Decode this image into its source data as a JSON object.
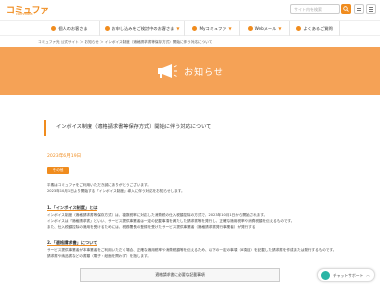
{
  "header": {
    "logo_text": "コミュファ",
    "logo_sub": "commufa",
    "search_placeholder": "サイト内を検索"
  },
  "nav": {
    "items": [
      {
        "label": "個人のお客さま"
      },
      {
        "label": "お申し込みをご検討中のお客さま"
      },
      {
        "label": "Myコミュファ"
      },
      {
        "label": "Webメール"
      },
      {
        "label": "よくあるご質問"
      }
    ]
  },
  "breadcrumb": "コミュファ光 公式サイト ＞ お知らせ ＞ インボイス制度（適格請求書等保存方式）開始に伴う対応について",
  "hero": {
    "title": "お知らせ"
  },
  "article": {
    "title": "インボイス制度（適格請求書等保存方式）開始に伴う対応について",
    "date": "2023年6月19日",
    "badge": "その他",
    "intro1": "平素はコミュファをご利用いただき誠にありがとうございます。",
    "intro2": "2023年10月1日より開始する「インボイス制度」導入に伴う対応をお知らせします。",
    "sec1_title": "1.「インボイス制度」とは",
    "sec1_l1": "インボイス制度（適格請求書等保存方式）は、複数税率に対応した消費税の仕入税額控除の方式で、2023年10月1日から開始されます。",
    "sec1_l2": "インボイスは「適格請求書」といい、サービス提供事業者は一定の記載事項を満たした請求書等を発行し、正確な適用税率や消費税額を伝えるものです。",
    "sec1_l3": "また、仕入税額控除の適用を受けるためには、税務署長の登録を受けたサービス提供事業者（適格請求書発行事業者）が発行する",
    "sec2_title": "2.「適格請求書」について",
    "sec2_l1": "サービス提供事業者が本事業者をご利用いただく場合、正確な適用税率や消費税額等を伝えるため、以下の一定の事項（8項目）を記載した請求書を作成または発行するものです。",
    "sec2_l2": "請求書や納品書などの書類（電子・紙面を問わず）を指します。",
    "table_header": "適格請求書に必要な記載事項"
  },
  "chat": {
    "label": "チャットサポート"
  },
  "colors": {
    "accent": "#f08c1e",
    "hero_bg": "#f5a256"
  }
}
